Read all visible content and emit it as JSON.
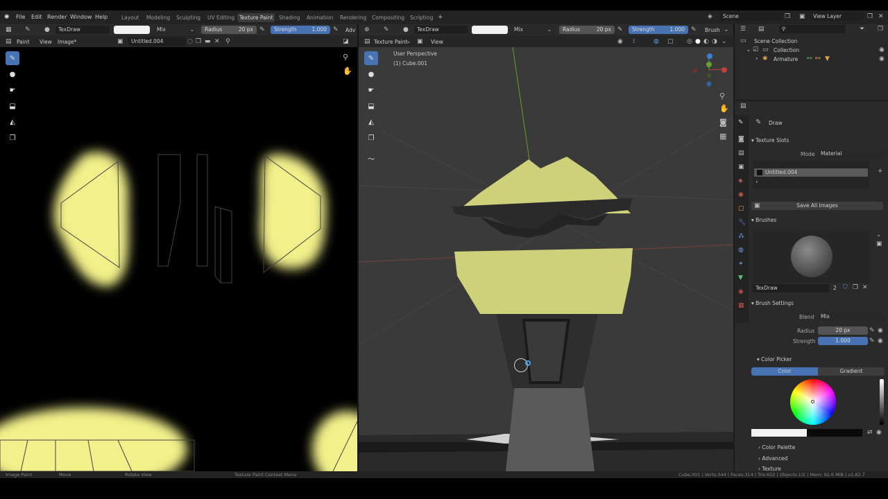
{
  "menu": {
    "items": [
      "File",
      "Edit",
      "Render",
      "Window",
      "Help"
    ]
  },
  "workspaces": [
    "Layout",
    "Modeling",
    "Sculpting",
    "UV Editing",
    "Texture Paint",
    "Shading",
    "Animation",
    "Rendering",
    "Compositing",
    "Scripting"
  ],
  "active_workspace": "Texture Paint",
  "scene": {
    "label": "Scene",
    "view_layer": "View Layer"
  },
  "image_editor": {
    "brush_name": "TexDraw",
    "blend": "Mix",
    "radius_label": "Radius",
    "radius_value": "20 px",
    "strength_label": "Strength",
    "strength_value": "1.000",
    "adv": "Adv",
    "mode": "Paint",
    "view": "View",
    "image_menu": "Image*",
    "image_name": "Untitled.004"
  },
  "viewport": {
    "brush_name": "TexDraw",
    "blend": "Mix",
    "radius_label": "Radius",
    "radius_value": "20 px",
    "strength_label": "Strength",
    "strength_value": "1.000",
    "brush_menu": "Brush",
    "mode": "Texture Paint",
    "view": "View",
    "perspective": "User Perspective",
    "object": "(1) Cube.001"
  },
  "outliner": {
    "scene_collection": "Scene Collection",
    "collection": "Collection",
    "armature": "Armature"
  },
  "properties": {
    "tool_name": "Draw",
    "texture_slots": "Texture Slots",
    "mode_label": "Mode",
    "mode_value": "Material",
    "slot": "Untitled.004",
    "save_all": "Save All Images",
    "brushes": "Brushes",
    "brush_name": "TexDraw",
    "brush_users": "2",
    "brush_settings": "Brush Settings",
    "blend_label": "Blend",
    "blend_value": "Mix",
    "radius_label": "Radius",
    "radius_value": "20 px",
    "strength_label": "Strength",
    "strength_value": "1.000",
    "color_picker": "Color Picker",
    "color_tab": "Color",
    "gradient_tab": "Gradient",
    "color_palette": "Color Palette",
    "advanced": "Advanced",
    "texture": "Texture"
  },
  "status": {
    "left": "Image Paint",
    "move": "Move",
    "rotate": "Rotate View",
    "context": "Texture Paint Context Menu",
    "stats": "Cube.001 | Verts:344 | Faces:314 | Tris:652 | Objects:1/2 | Mem: 92.6 MiB | v2.82.7"
  },
  "colors": {
    "accent": "#4772b3",
    "paint_yellow": "#f2f08a",
    "model_yellow": "#cfd17a"
  }
}
